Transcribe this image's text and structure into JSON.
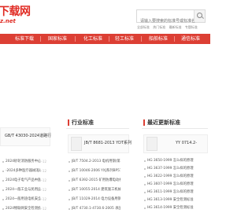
{
  "header": {
    "logo_text": "下载网",
    "logo_sub": "z.net",
    "search_placeholder": "请输入要搜索的标准号或标准名称",
    "hot_links": [
      "全部标准",
      "热门标准",
      "最新标准",
      "专题标准"
    ]
  },
  "nav": {
    "items": [
      "标准下载",
      "国家标准",
      "化工标准",
      "轻工标准",
      "船舶标准",
      "通信标准"
    ]
  },
  "left_column": {
    "feature_title": "GB/T 43030-2024道路行",
    "items": [
      "2024砂轮消防服务中心",
      "-2024多种医疗器械消毒",
      "2024电子电气产品中限",
      "2024一般工业与民用设",
      "2024一般用途电机安全",
      "2024物联网安全检测机"
    ],
    "dates": [
      "09-12",
      "09-12",
      "09-12",
      "09-12",
      "09-12",
      "09-12"
    ]
  },
  "middle_column": {
    "title": "行业标准",
    "more": "更多",
    "feature_title": "JB/T 8681-2013 YDT系列",
    "items": [
      "JB/T 7504.2-2013 电机用钢(第2部",
      "JB/T 10046-2006 YXJ系列BP51系",
      "JB/T 6392-2015 矿用防爆电动机",
      "JB/T 10055-2014 建筑施工机械与设",
      "JB/T 11029-2014 电力设备用钢管",
      "JB/T 4730.1-4730.6-2005 承压设备无"
    ],
    "dates": [
      "09-12",
      "09-12",
      "09-12",
      "09-12",
      "09-12",
      "09-12"
    ]
  },
  "right_column": {
    "title": "最近更新标准",
    "more": "更多",
    "feature_title": "YY 0714.2-",
    "items": [
      "HG 3650-1999 怎么样的原理",
      "HG 3637-1999 怎么样的原理",
      "HG 3622-1999 怎么样的原理",
      "HG 3607-1999 怎么样的原理",
      "HG 3611-1999 怎么样的原理",
      "HG 3613-1999 安全检测标准",
      "HG 3614-1999 安全检测标准"
    ],
    "dates": [
      "09-12",
      "09-12",
      "09-12",
      "09-12",
      "09-12",
      "09-12",
      "09-12"
    ]
  }
}
